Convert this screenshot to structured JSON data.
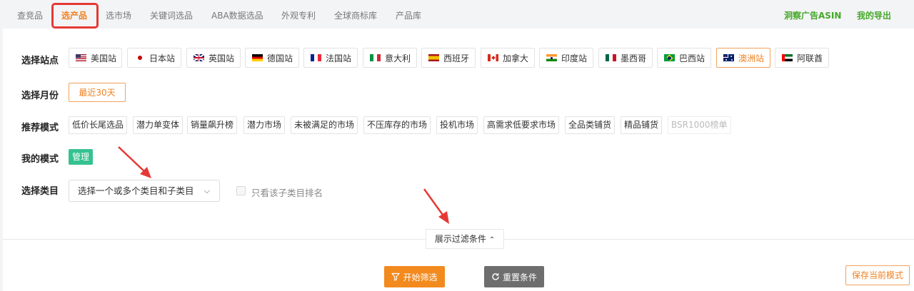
{
  "nav": {
    "items": [
      {
        "label": "查竞品"
      },
      {
        "label": "选产品"
      },
      {
        "label": "选市场"
      },
      {
        "label": "关键词选品"
      },
      {
        "label": "ABA数据选品"
      },
      {
        "label": "外观专利"
      },
      {
        "label": "全球商标库"
      },
      {
        "label": "产品库"
      }
    ],
    "right": [
      {
        "label": "洞察广告ASIN"
      },
      {
        "label": "我的导出"
      }
    ]
  },
  "filters": {
    "site_label": "选择站点",
    "sites": [
      {
        "label": "美国站",
        "flag": "us-flag-icon"
      },
      {
        "label": "日本站",
        "flag": "jp-flag-icon"
      },
      {
        "label": "英国站",
        "flag": "uk-flag-icon"
      },
      {
        "label": "德国站",
        "flag": "de-flag-icon"
      },
      {
        "label": "法国站",
        "flag": "fr-flag-icon"
      },
      {
        "label": "意大利",
        "flag": "it-flag-icon"
      },
      {
        "label": "西班牙",
        "flag": "es-flag-icon"
      },
      {
        "label": "加拿大",
        "flag": "ca-flag-icon"
      },
      {
        "label": "印度站",
        "flag": "in-flag-icon"
      },
      {
        "label": "墨西哥",
        "flag": "mx-flag-icon"
      },
      {
        "label": "巴西站",
        "flag": "br-flag-icon"
      },
      {
        "label": "澳洲站",
        "flag": "au-flag-icon"
      },
      {
        "label": "阿联酋",
        "flag": "ae-flag-icon"
      }
    ],
    "month_label": "选择月份",
    "month_value": "最近30天",
    "mode_label": "推荐模式",
    "modes": [
      {
        "label": "低价长尾选品"
      },
      {
        "label": "潜力单变体"
      },
      {
        "label": "销量飙升榜"
      },
      {
        "label": "潜力市场"
      },
      {
        "label": "未被满足的市场"
      },
      {
        "label": "不压库存的市场"
      },
      {
        "label": "投机市场"
      },
      {
        "label": "高需求低要求市场"
      },
      {
        "label": "全品类铺货"
      },
      {
        "label": "精品铺货"
      },
      {
        "label": "BSR1000榜单"
      }
    ],
    "my_mode_label": "我的模式",
    "manage_label": "管理",
    "category_label": "选择类目",
    "category_placeholder": "选择一个或多个类目和子类目",
    "subcategory_only_label": "只看该子类目排名"
  },
  "actions": {
    "toggle_filters": "展示过滤条件",
    "start": "开始筛选",
    "reset": "重置条件",
    "save_mode": "保存当前模式"
  },
  "colors": {
    "accent": "#f0801f",
    "green_link": "#45a829",
    "manage_green": "#36c290",
    "annotation_red": "#e53935"
  }
}
